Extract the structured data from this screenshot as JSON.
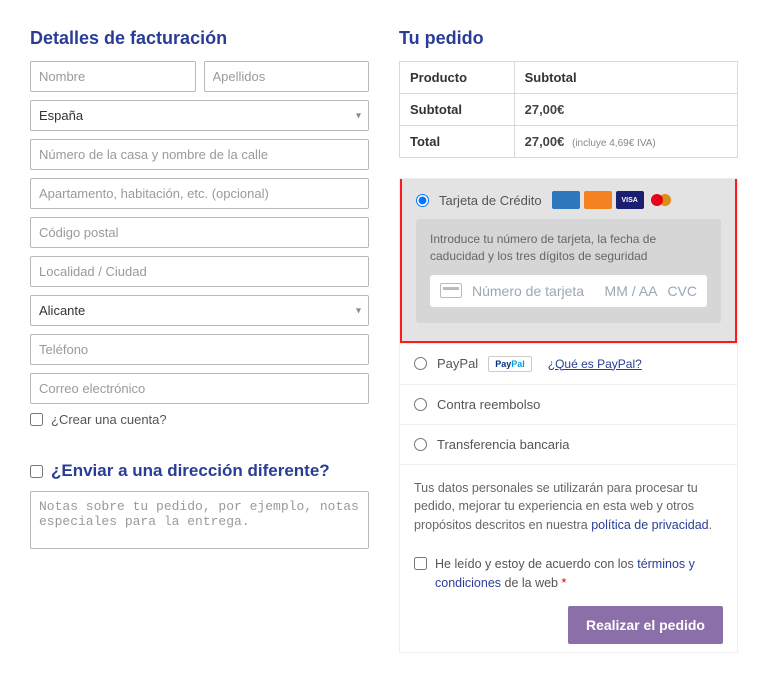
{
  "billing": {
    "title": "Detalles de facturación",
    "first_name_ph": "Nombre",
    "last_name_ph": "Apellidos",
    "country_value": "España",
    "address1_ph": "Número de la casa y nombre de la calle",
    "address2_ph": "Apartamento, habitación, etc. (opcional)",
    "postcode_ph": "Código postal",
    "city_ph": "Localidad / Ciudad",
    "province_value": "Alicante",
    "phone_ph": "Teléfono",
    "email_ph": "Correo electrónico",
    "create_account_label": "¿Crear una cuenta?"
  },
  "shipping": {
    "diff_title": "¿Enviar a una dirección diferente?",
    "notes_ph": "Notas sobre tu pedido, por ejemplo, notas especiales para la entrega."
  },
  "order": {
    "title": "Tu pedido",
    "col_product": "Producto",
    "col_subtotal": "Subtotal",
    "row_subtotal": "Subtotal",
    "row_total": "Total",
    "subtotal_value": "27,00€",
    "total_value": "27,00€",
    "tax_note": "(incluye 4,69€ IVA)"
  },
  "payments": {
    "cc": {
      "label": "Tarjeta de Crédito",
      "desc": "Introduce tu número de tarjeta, la fecha de caducidad y los tres dígitos de seguridad",
      "num_ph": "Número de tarjeta",
      "exp_ph": "MM / AA",
      "cvc_ph": "CVC"
    },
    "paypal": {
      "label": "PayPal",
      "what": "¿Qué es PayPal?"
    },
    "cod": {
      "label": "Contra reembolso"
    },
    "bank": {
      "label": "Transferencia bancaria"
    }
  },
  "privacy": {
    "text_before": "Tus datos personales se utilizarán para procesar tu pedido, mejorar tu experiencia en esta web y otros propósitos descritos en nuestra ",
    "link": "política de privacidad",
    "text_after": "."
  },
  "terms": {
    "before": "He leído y estoy de acuerdo con los ",
    "link": "términos y condiciones",
    "after": " de la web ",
    "required": "*"
  },
  "submit": {
    "label": "Realizar el pedido"
  }
}
